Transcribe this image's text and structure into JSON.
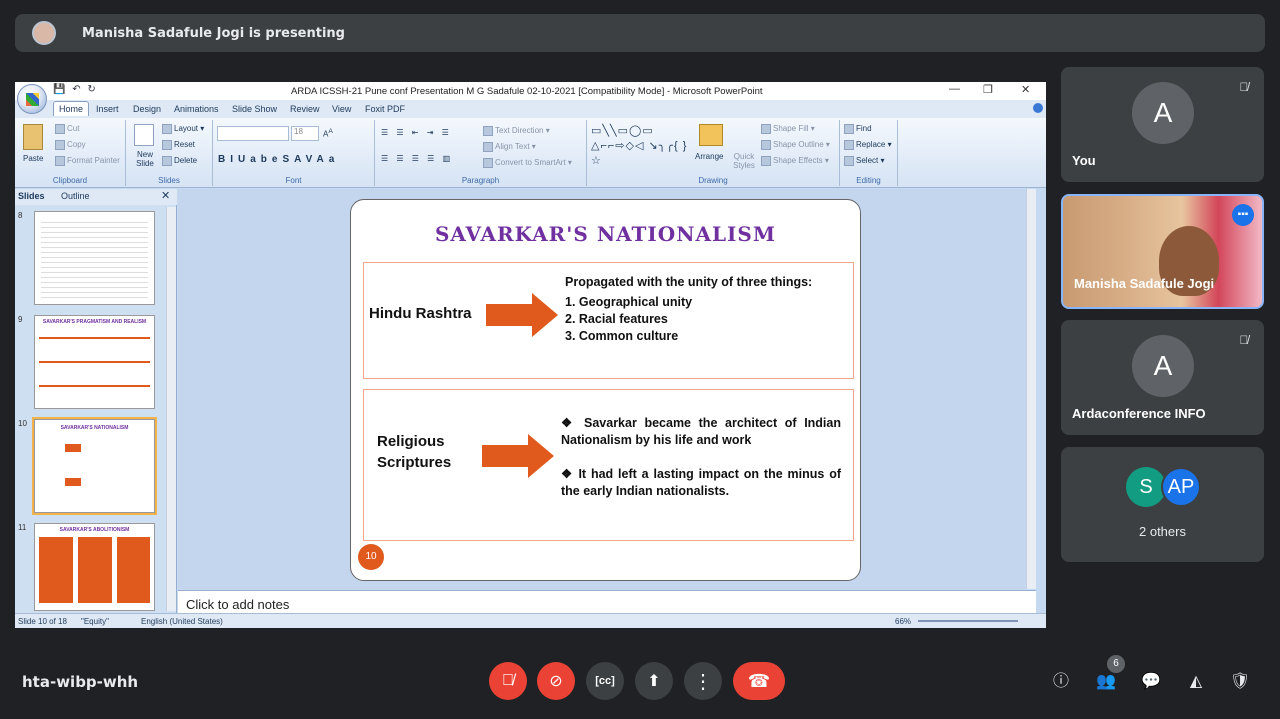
{
  "banner": {
    "presenter_text": "Manisha Sadafule Jogi is presenting"
  },
  "ppt": {
    "window_title": "ARDA ICSSH-21 Pune  conf Presentation M G Sadafule 02-10-2021 [Compatibility Mode] - Microsoft PowerPoint",
    "tabs": [
      "Home",
      "Insert",
      "Design",
      "Animations",
      "Slide Show",
      "Review",
      "View",
      "Foxit PDF"
    ],
    "clipboard": {
      "paste": "Paste",
      "cut": "Cut",
      "copy": "Copy",
      "format_painter": "Format Painter",
      "label": "Clipboard"
    },
    "slides_group": {
      "new_slide": "New Slide",
      "layout": "Layout",
      "reset": "Reset",
      "delete": "Delete",
      "label": "Slides"
    },
    "font_group": {
      "size": "18",
      "label": "Font"
    },
    "paragraph_group": {
      "text_direction": "Text Direction",
      "align_text": "Align Text",
      "smartart": "Convert to SmartArt",
      "label": "Paragraph"
    },
    "drawing_group": {
      "arrange": "Arrange",
      "quick_styles": "Quick Styles",
      "shape_fill": "Shape Fill",
      "shape_outline": "Shape Outline",
      "shape_effects": "Shape Effects",
      "label": "Drawing"
    },
    "editing_group": {
      "find": "Find",
      "replace": "Replace",
      "select": "Select",
      "label": "Editing"
    },
    "pane_tabs": {
      "slides": "Slides",
      "outline": "Outline"
    },
    "thumbs": [
      {
        "num": "8"
      },
      {
        "num": "9",
        "title": "SAVARKAR'S PRAGMATISM AND REALISM"
      },
      {
        "num": "10",
        "title": "SAVARKAR'S NATIONALISM"
      },
      {
        "num": "11",
        "title": "SAVARKAR'S ABOLITIONISM"
      }
    ],
    "notes_placeholder": "Click to add notes",
    "status": {
      "slide": "Slide 10 of 18",
      "theme": "\"Equity\"",
      "language": "English (United States)",
      "zoom": "66%"
    }
  },
  "slide": {
    "title": "SAVARKAR'S  NATIONALISM",
    "box1": {
      "label": "Hindu Rashtra",
      "heading": "Propagated with the unity of three things:",
      "items": [
        "1. Geographical unity",
        "2. Racial features",
        "3. Common culture"
      ]
    },
    "box2": {
      "label_line1": "Religious",
      "label_line2": "Scriptures",
      "point1": "❖ Savarkar became the architect of Indian Nationalism by his life and work",
      "point2": "❖ It had left a lasting impact on the minus of the early Indian nationalists."
    },
    "number": "10",
    "arrow_color": "#e05a1e",
    "title_color": "#7030a0"
  },
  "participants": [
    {
      "initial": "A",
      "name": "You"
    },
    {
      "name": "Manisha Sadafule Jogi"
    },
    {
      "initial": "A",
      "name": "Ardaconference INFO"
    },
    {
      "name": "2 others",
      "avatars": [
        "S",
        "AP"
      ]
    }
  ],
  "meeting": {
    "code": "hta-wibp-whh",
    "people_count": "6"
  },
  "icons": [
    "mic-off-icon",
    "camera-off-icon",
    "captions-icon",
    "present-icon",
    "more-icon",
    "end-call-icon",
    "info-icon",
    "people-icon",
    "chat-icon",
    "activities-icon",
    "host-controls-icon"
  ]
}
